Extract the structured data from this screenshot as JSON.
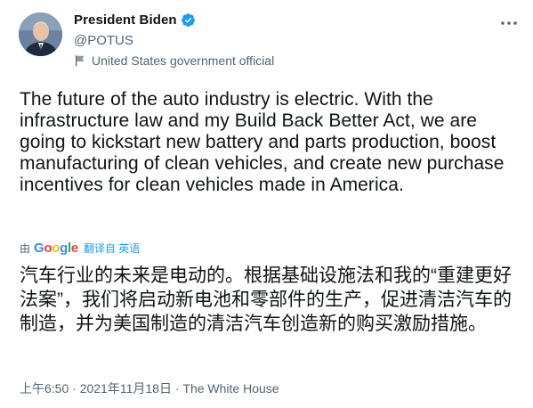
{
  "author": {
    "name": "President Biden",
    "handle": "@POTUS",
    "label": "United States government official",
    "verified_color": "#1d9bf0"
  },
  "tweet": {
    "text": "The future of the auto industry is electric. With the infrastructure law and my Build Back Better Act, we are going to kickstart new battery and parts production, boost manufacturing of clean vehicles, and create new purchase incentives for clean vehicles made in America."
  },
  "translation": {
    "by_label": "由",
    "provider_letters": [
      "G",
      "o",
      "o",
      "g",
      "l",
      "e"
    ],
    "link_label": "翻译自 英语",
    "text": "汽车行业的未来是电动的。根据基础设施法和我的“重建更好法案”，我们将启动新电池和零部件的生产，促进清洁汽车的制造，并为美国制造的清洁汽车创造新的购买激励措施。"
  },
  "meta": {
    "time": "上午6:50",
    "separator": " · ",
    "date": "2021年11月18日",
    "source": "The White House"
  },
  "icons": {
    "more": "more-horizontal-icon",
    "verified": "verified-badge-icon",
    "label": "flag-icon"
  }
}
